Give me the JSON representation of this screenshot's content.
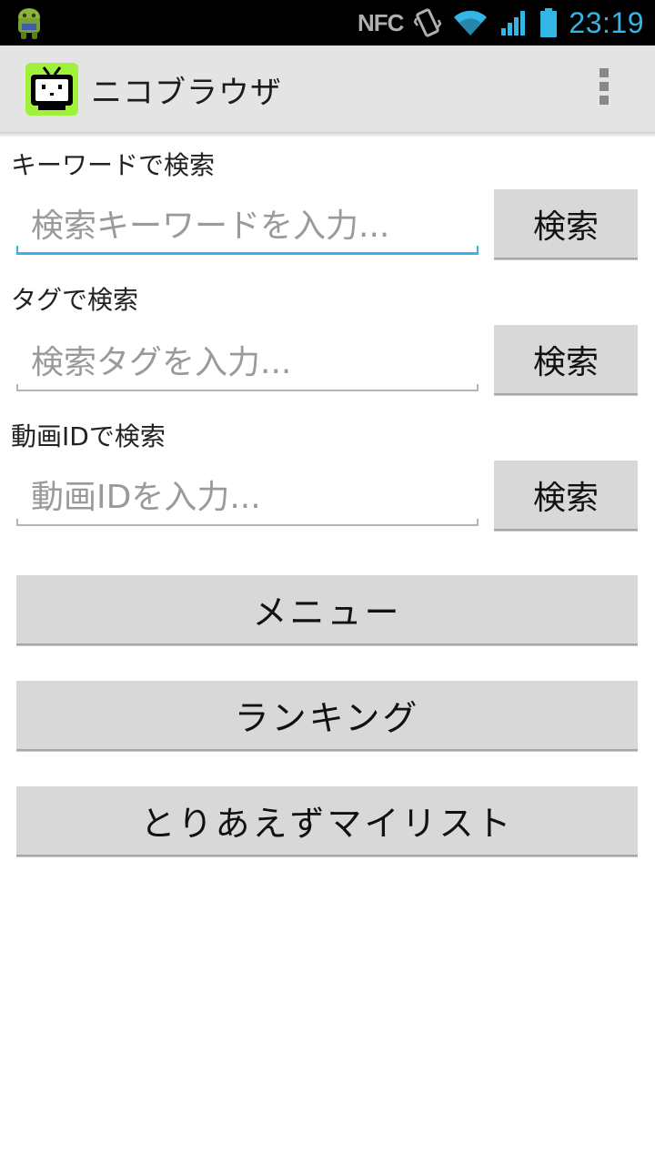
{
  "status_bar": {
    "time": "23:19",
    "nfc_label": "NFC",
    "icons": [
      "android-notification-icon",
      "nfc-icon",
      "vibrate-icon",
      "wifi-icon",
      "signal-icon",
      "battery-icon"
    ]
  },
  "action_bar": {
    "title": "ニコブラウザ",
    "icon": "niconico-tv-icon",
    "overflow_icon": "overflow-menu-icon"
  },
  "keyword_search": {
    "label": "キーワードで検索",
    "placeholder": "検索キーワードを入力...",
    "value": "",
    "button_label": "検索"
  },
  "tag_search": {
    "label": "タグで検索",
    "placeholder": "検索タグを入力...",
    "value": "",
    "button_label": "検索"
  },
  "video_id_search": {
    "label": "動画IDで検索",
    "placeholder": "動画IDを入力...",
    "value": "",
    "button_label": "検索"
  },
  "menu_buttons": [
    {
      "label": "メニュー"
    },
    {
      "label": "ランキング"
    },
    {
      "label": "とりあえずマイリスト"
    }
  ],
  "colors": {
    "accent": "#33b5e5",
    "action_bar_bg": "#e4e4e4",
    "button_bg": "#d8d8d8",
    "app_icon_bg": "#9ff13a"
  }
}
